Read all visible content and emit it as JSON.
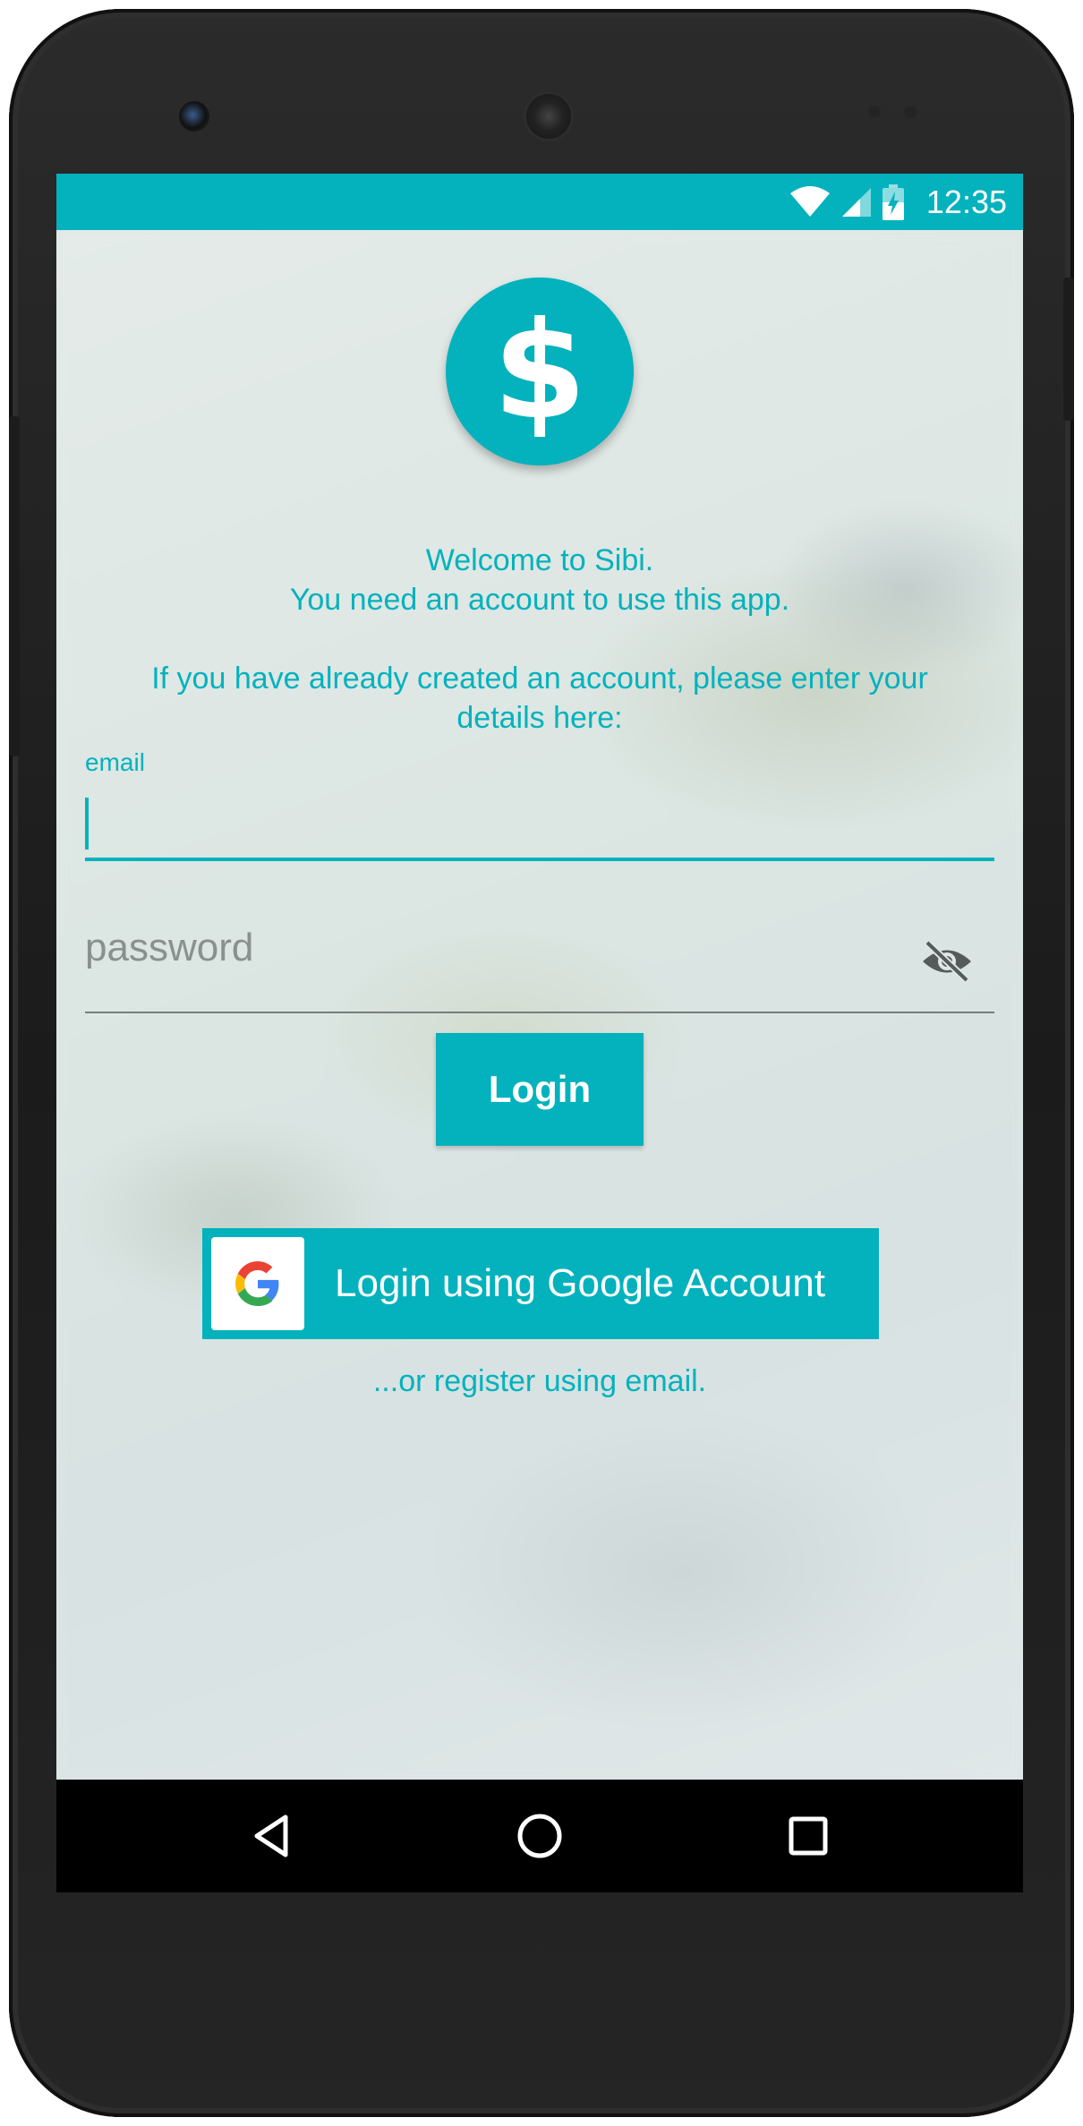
{
  "status_bar": {
    "time": "12:35",
    "icons": [
      "wifi-icon",
      "signal-icon",
      "battery-charging-icon"
    ]
  },
  "logo": {
    "symbol": "$",
    "icon": "dollar-icon"
  },
  "welcome": {
    "line1": "Welcome to Sibi.",
    "line2": "You need an account to use this app.",
    "line3": "If you have already created an account, please enter your",
    "line4": "details here:"
  },
  "email": {
    "label": "email",
    "value": ""
  },
  "password": {
    "placeholder": "password",
    "toggle_icon": "visibility-off-icon"
  },
  "login_button": {
    "label": "Login"
  },
  "google_button": {
    "label": "Login using Google Account",
    "icon": "google-icon"
  },
  "register_link": {
    "label": "...or register using email."
  },
  "nav_bar": {
    "buttons": [
      "back-icon",
      "home-icon",
      "recents-icon"
    ]
  },
  "colors": {
    "accent": "#03b2bd",
    "nav_bar": "#000000",
    "hint_text": "#8a8f8f"
  }
}
